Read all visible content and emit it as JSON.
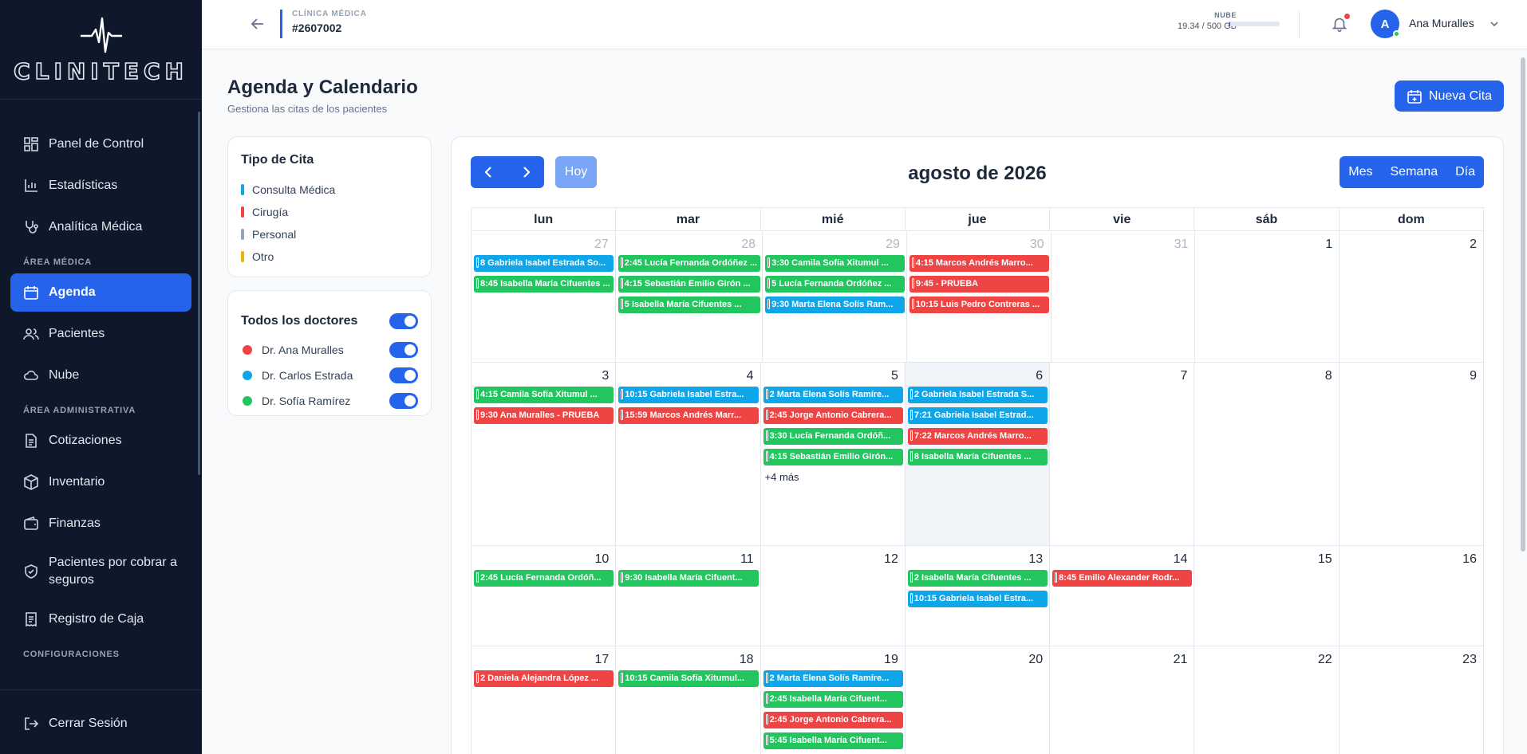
{
  "brand": {
    "name": "CLINITECH"
  },
  "colors": {
    "accent": "#2563eb",
    "cirugia": "#ef4444",
    "consulta": "#22c55e",
    "carlos": "#0ea5e9",
    "personal": "#94a3b8",
    "otro": "#eab308"
  },
  "sidebar": {
    "items": [
      {
        "label": "Panel de Control",
        "icon": "dashboard-icon"
      },
      {
        "label": "Estadísticas",
        "icon": "bar-chart-icon"
      },
      {
        "label": "Analítica Médica",
        "icon": "stethoscope-icon"
      },
      {
        "label": "Agenda",
        "icon": "calendar-icon"
      },
      {
        "label": "Pacientes",
        "icon": "users-icon"
      },
      {
        "label": "Nube",
        "icon": "cloud-icon"
      },
      {
        "label": "Cotizaciones",
        "icon": "document-icon"
      },
      {
        "label": "Inventario",
        "icon": "box-icon"
      },
      {
        "label": "Finanzas",
        "icon": "wallet-icon"
      },
      {
        "label": "Pacientes por cobrar a seguros",
        "icon": "shield-check-icon"
      },
      {
        "label": "Registro de Caja",
        "icon": "receipt-icon"
      }
    ],
    "sections": {
      "medica": "ÁREA MÉDICA",
      "admin": "ÁREA ADMINISTRATIVA",
      "config": "CONFIGURACIONES"
    },
    "logout": "Cerrar Sesión"
  },
  "topbar": {
    "clinic_label": "CLÍNICA MÉDICA",
    "clinic_id": "#2607002",
    "cloud_label": "NUBE",
    "cloud_usage": "19.34 / 500 GB",
    "cloud_fraction": 0.039,
    "user_initial": "A",
    "user_name": "Ana Muralles"
  },
  "page": {
    "title": "Agenda y Calendario",
    "subtitle": "Gestiona las citas de los pacientes",
    "new_button": "Nueva Cita"
  },
  "legend": {
    "title": "Tipo de Cita",
    "items": [
      {
        "label": "Consulta Médica",
        "color": "#0ea5e9"
      },
      {
        "label": "Cirugía",
        "color": "#ef4444"
      },
      {
        "label": "Personal",
        "color": "#94a3b8"
      },
      {
        "label": "Otro",
        "color": "#eab308"
      }
    ]
  },
  "doctors": {
    "title": "Todos los doctores",
    "items": [
      {
        "name": "Dr. Ana Muralles",
        "color": "#ef4444"
      },
      {
        "name": "Dr. Carlos Estrada",
        "color": "#0ea5e9"
      },
      {
        "name": "Dr. Sofía Ramírez",
        "color": "#22c55e"
      }
    ]
  },
  "calendar": {
    "title": "agosto de 2026",
    "today_label": "Hoy",
    "views": [
      "Mes",
      "Semana",
      "Día"
    ],
    "weekdays": [
      "lun",
      "mar",
      "mié",
      "jue",
      "vie",
      "sáb",
      "dom"
    ],
    "weeks": [
      {
        "days": [
          {
            "n": "27",
            "other": true,
            "events": [
              {
                "t": "8  Gabriela Isabel Estrada So...",
                "c": "b"
              },
              {
                "t": "8:45  Isabella María Cifuentes ...",
                "c": "g"
              }
            ]
          },
          {
            "n": "28",
            "other": true,
            "events": [
              {
                "t": "2:45  Lucía Fernanda Ordóñez ...",
                "c": "g"
              },
              {
                "t": "4:15  Sebastián Emilio Girón ...",
                "c": "g"
              },
              {
                "t": "5  Isabella María Cifuentes ...",
                "c": "g"
              }
            ]
          },
          {
            "n": "29",
            "other": true,
            "events": [
              {
                "t": "3:30  Camila Sofía Xitumul ...",
                "c": "g"
              },
              {
                "t": "5  Lucía Fernanda Ordóñez ...",
                "c": "g"
              },
              {
                "t": "9:30  Marta Elena Solís Ram...",
                "c": "b"
              }
            ]
          },
          {
            "n": "30",
            "other": true,
            "events": [
              {
                "t": "4:15  Marcos Andrés Marro...",
                "c": "r"
              },
              {
                "t": "9:45  - PRUEBA",
                "c": "r"
              },
              {
                "t": "10:15  Luis Pedro Contreras ...",
                "c": "r"
              }
            ]
          },
          {
            "n": "31",
            "other": true,
            "events": []
          },
          {
            "n": "1",
            "events": []
          },
          {
            "n": "2",
            "events": []
          }
        ]
      },
      {
        "days": [
          {
            "n": "3",
            "events": [
              {
                "t": "4:15  Camila Sofía Xitumul ...",
                "c": "g"
              },
              {
                "t": "9:30  Ana Muralles - PRUEBA",
                "c": "r"
              }
            ]
          },
          {
            "n": "4",
            "events": [
              {
                "t": "10:15  Gabriela Isabel Estra...",
                "c": "b"
              },
              {
                "t": "15:59  Marcos Andrés Marr...",
                "c": "r"
              }
            ]
          },
          {
            "n": "5",
            "events": [
              {
                "t": "2  Marta Elena Solís Ramíre...",
                "c": "b"
              },
              {
                "t": "2:45  Jorge Antonio Cabrera...",
                "c": "r"
              },
              {
                "t": "3:30  Lucía Fernanda Ordóñ...",
                "c": "g"
              },
              {
                "t": "4:15  Sebastián Emilio Girón...",
                "c": "g"
              }
            ],
            "more": "+4 más"
          },
          {
            "n": "6",
            "today": true,
            "events": [
              {
                "t": "2  Gabriela Isabel Estrada S...",
                "c": "b"
              },
              {
                "t": "7:21  Gabriela Isabel Estrad...",
                "c": "b"
              },
              {
                "t": "7:22  Marcos Andrés Marro...",
                "c": "r"
              },
              {
                "t": "8  Isabella María Cifuentes ...",
                "c": "g"
              }
            ]
          },
          {
            "n": "7",
            "events": []
          },
          {
            "n": "8",
            "events": []
          },
          {
            "n": "9",
            "events": []
          }
        ]
      },
      {
        "days": [
          {
            "n": "10",
            "events": [
              {
                "t": "2:45  Lucía Fernanda Ordóñ...",
                "c": "g"
              }
            ]
          },
          {
            "n": "11",
            "events": [
              {
                "t": "9:30  Isabella María Cifuent...",
                "c": "g"
              }
            ]
          },
          {
            "n": "12",
            "events": []
          },
          {
            "n": "13",
            "events": [
              {
                "t": "2  Isabella María Cifuentes ...",
                "c": "g"
              },
              {
                "t": "10:15  Gabriela Isabel Estra...",
                "c": "b"
              }
            ]
          },
          {
            "n": "14",
            "events": [
              {
                "t": "8:45  Emilio Alexander Rodr...",
                "c": "r"
              }
            ]
          },
          {
            "n": "15",
            "events": []
          },
          {
            "n": "16",
            "events": []
          }
        ]
      },
      {
        "days": [
          {
            "n": "17",
            "events": [
              {
                "t": "2  Daniela Alejandra López ...",
                "c": "r"
              }
            ]
          },
          {
            "n": "18",
            "events": [
              {
                "t": "10:15  Camila Sofía Xitumul...",
                "c": "g"
              }
            ]
          },
          {
            "n": "19",
            "events": [
              {
                "t": "2  Marta Elena Solís Ramíre...",
                "c": "b"
              },
              {
                "t": "2:45  Isabella María Cifuent...",
                "c": "g"
              },
              {
                "t": "2:45  Jorge Antonio Cabrera...",
                "c": "r"
              },
              {
                "t": "5:45  Isabella María Cifuent...",
                "c": "g"
              }
            ]
          },
          {
            "n": "20",
            "events": []
          },
          {
            "n": "21",
            "events": []
          },
          {
            "n": "22",
            "events": []
          },
          {
            "n": "23",
            "events": []
          }
        ]
      }
    ]
  }
}
